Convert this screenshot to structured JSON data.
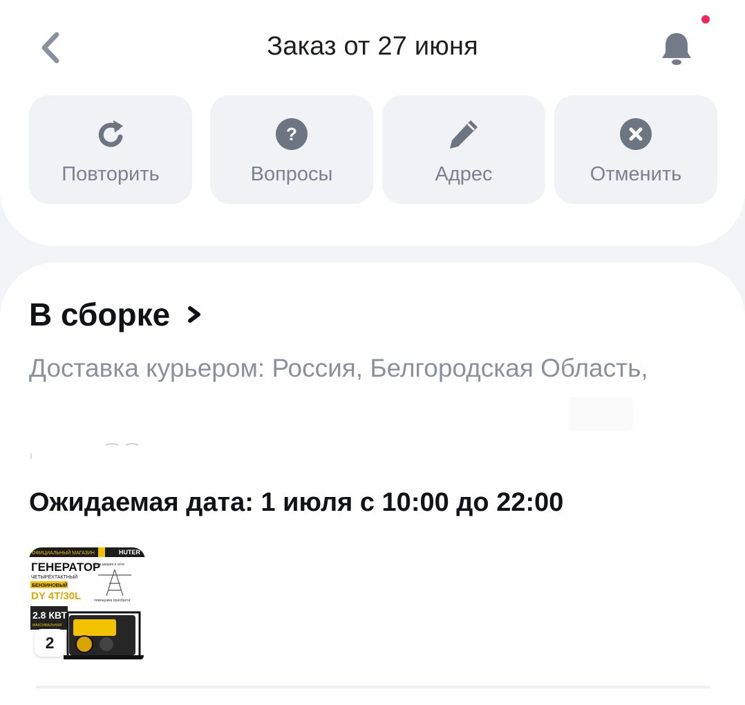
{
  "header": {
    "title": "Заказ от 27 июня",
    "accent_color": "#f0265e"
  },
  "actions": [
    {
      "label": "Повторить",
      "icon": "repeat-icon"
    },
    {
      "label": "Вопросы",
      "icon": "question-icon"
    },
    {
      "label": "Адрес",
      "icon": "pencil-icon"
    },
    {
      "label": "Отменить",
      "icon": "cancel-icon"
    }
  ],
  "order": {
    "status": "В сборке",
    "delivery": "Доставка курьером: Россия, Белгородская Область,",
    "eta": "Ожидаемая дата: 1 июля с 10:00 до 22:00"
  },
  "product": {
    "quantity": "2",
    "image_text": {
      "shop": "ОФИЦИАЛЬНЫЙ МАГАЗИН",
      "brand": "HUTER",
      "title": "ГЕНЕРАТОР",
      "sub1": "ЧЕТЫРЁХТАКТНЫЙ",
      "sub2": "БЕНЗИНОВЫЙ",
      "model": "DY 4T/30L",
      "power": "2.8 КВТ",
      "power_note": "МАКСИМАЛЬНАЯ",
      "tag1": "когда авария в сети",
      "tag2": "помощника приобрети"
    }
  }
}
